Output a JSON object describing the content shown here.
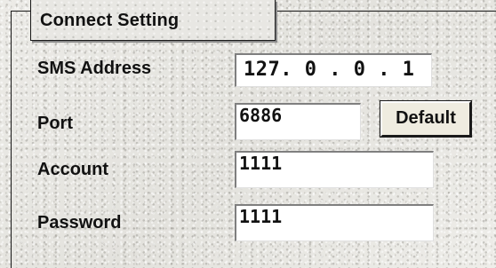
{
  "group": {
    "title": "Connect Setting"
  },
  "fields": {
    "sms_address": {
      "label": "SMS Address",
      "value": "127. 0 . 0 . 1"
    },
    "port": {
      "label": "Port",
      "value": "6886"
    },
    "account": {
      "label": "Account",
      "value": "1111"
    },
    "password": {
      "label": "Password",
      "value": "1111"
    }
  },
  "buttons": {
    "default_label": "Default"
  }
}
